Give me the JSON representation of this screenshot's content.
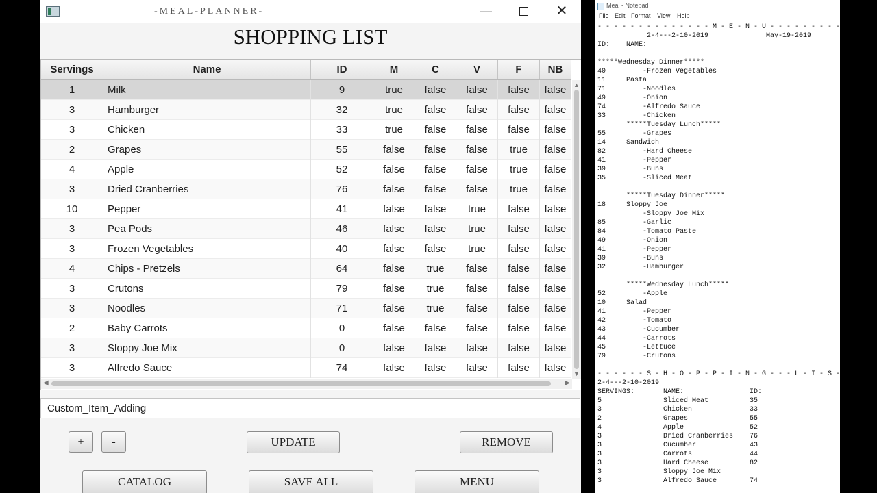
{
  "app": {
    "window_title": "-MEAL-PLANNER-",
    "window_controls": {
      "minimize": "—",
      "maximize": "",
      "close": "✕"
    },
    "heading": "SHOPPING LIST"
  },
  "table": {
    "columns": [
      "Servings",
      "Name",
      "ID",
      "M",
      "C",
      "V",
      "F",
      "NB"
    ],
    "rows": [
      {
        "servings": "1",
        "name": "Milk",
        "id": "9",
        "m": "true",
        "c": "false",
        "v": "false",
        "f": "false",
        "nb": "false",
        "selected": true
      },
      {
        "servings": "3",
        "name": "Hamburger",
        "id": "32",
        "m": "true",
        "c": "false",
        "v": "false",
        "f": "false",
        "nb": "false"
      },
      {
        "servings": "3",
        "name": "Chicken",
        "id": "33",
        "m": "true",
        "c": "false",
        "v": "false",
        "f": "false",
        "nb": "false"
      },
      {
        "servings": "2",
        "name": "Grapes",
        "id": "55",
        "m": "false",
        "c": "false",
        "v": "false",
        "f": "true",
        "nb": "false"
      },
      {
        "servings": "4",
        "name": "Apple",
        "id": "52",
        "m": "false",
        "c": "false",
        "v": "false",
        "f": "true",
        "nb": "false"
      },
      {
        "servings": "3",
        "name": "Dried Cranberries",
        "id": "76",
        "m": "false",
        "c": "false",
        "v": "false",
        "f": "true",
        "nb": "false"
      },
      {
        "servings": "10",
        "name": "Pepper",
        "id": "41",
        "m": "false",
        "c": "false",
        "v": "true",
        "f": "false",
        "nb": "false"
      },
      {
        "servings": "3",
        "name": "Pea Pods",
        "id": "46",
        "m": "false",
        "c": "false",
        "v": "true",
        "f": "false",
        "nb": "false"
      },
      {
        "servings": "3",
        "name": "Frozen Vegetables",
        "id": "40",
        "m": "false",
        "c": "false",
        "v": "true",
        "f": "false",
        "nb": "false"
      },
      {
        "servings": "4",
        "name": "Chips - Pretzels",
        "id": "64",
        "m": "false",
        "c": "true",
        "v": "false",
        "f": "false",
        "nb": "false"
      },
      {
        "servings": "3",
        "name": "Crutons",
        "id": "79",
        "m": "false",
        "c": "true",
        "v": "false",
        "f": "false",
        "nb": "false"
      },
      {
        "servings": "3",
        "name": "Noodles",
        "id": "71",
        "m": "false",
        "c": "true",
        "v": "false",
        "f": "false",
        "nb": "false"
      },
      {
        "servings": "2",
        "name": "Baby Carrots",
        "id": "0",
        "m": "false",
        "c": "false",
        "v": "false",
        "f": "false",
        "nb": "false"
      },
      {
        "servings": "3",
        "name": "Sloppy Joe Mix",
        "id": "0",
        "m": "false",
        "c": "false",
        "v": "false",
        "f": "false",
        "nb": "false"
      },
      {
        "servings": "3",
        "name": "Alfredo Sauce",
        "id": "74",
        "m": "false",
        "c": "false",
        "v": "false",
        "f": "false",
        "nb": "false"
      }
    ]
  },
  "custom_input": {
    "value": "Custom_Item_Adding"
  },
  "buttons": {
    "plus": "+",
    "minus": "-",
    "update": "UPDATE",
    "remove": "REMOVE",
    "catalog": "CATALOG",
    "save_all": "SAVE ALL",
    "menu": "MENU"
  },
  "notepad": {
    "title": "Meal - Notepad",
    "menu": [
      "File",
      "Edit",
      "Format",
      "View",
      "Help"
    ],
    "lines": [
      "- - - - - - - - - - - - - - M - E - N - U - - - - - - - - - - - -",
      "            2-4---2-10-2019              May-19-2019",
      "ID:    NAME:",
      "",
      "*****Wednesday Dinner*****",
      "40         -Frozen Vegetables",
      "11     Pasta",
      "71         -Noodles",
      "49         -Onion",
      "74         -Alfredo Sauce",
      "33         -Chicken",
      "       *****Tuesday Lunch*****",
      "55         -Grapes",
      "14     Sandwich",
      "82         -Hard Cheese",
      "41         -Pepper",
      "39         -Buns",
      "35         -Sliced Meat",
      "",
      "       *****Tuesday Dinner*****",
      "18     Sloppy Joe",
      "           -Sloppy Joe Mix",
      "85         -Garlic",
      "84         -Tomato Paste",
      "49         -Onion",
      "41         -Pepper",
      "39         -Buns",
      "32         -Hamburger",
      "",
      "       *****Wednesday Lunch*****",
      "52         -Apple",
      "10     Salad",
      "41         -Pepper",
      "42         -Tomato",
      "43         -Cucumber",
      "44         -Carrots",
      "45         -Lettuce",
      "79         -Crutons",
      "",
      "- - - - - - S - H - O - P - P - I - N - G - - - L - I - S - T - -",
      "2-4---2-10-2019",
      "SERVINGS:       NAME:                ID:",
      "5               Sliced Meat          35",
      "3               Chicken              33",
      "2               Grapes               55",
      "4               Apple                52",
      "3               Dried Cranberries    76",
      "3               Cucumber             43",
      "3               Carrots              44",
      "3               Hard Cheese          82",
      "3               Sloppy Joe Mix",
      "3               Alfredo Sauce        74"
    ]
  }
}
